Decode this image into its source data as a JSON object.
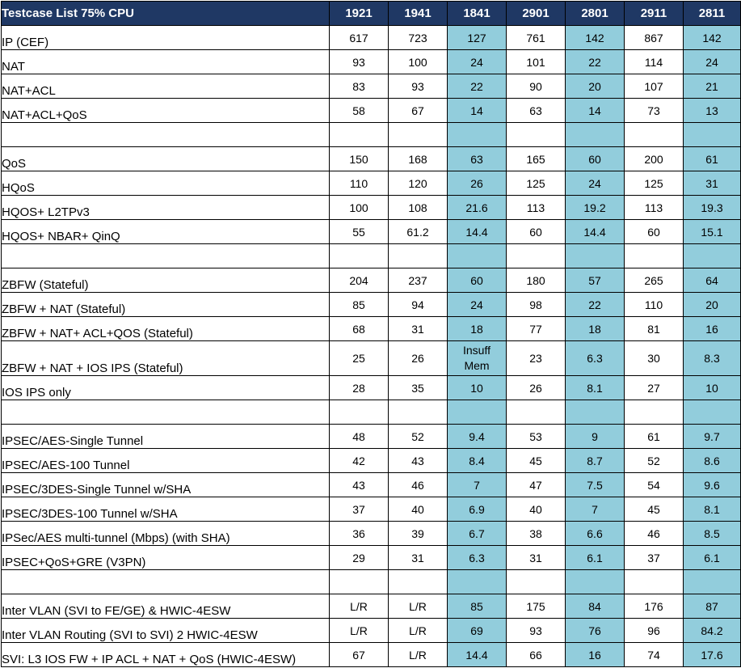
{
  "table": {
    "columns": [
      "Testcase List 75% CPU",
      "1921",
      "1941",
      "1841",
      "2901",
      "2801",
      "2911",
      "2811"
    ],
    "highlight_columns": [
      3,
      5,
      7
    ],
    "rows": [
      {
        "label": "IP (CEF)",
        "values": [
          "617",
          "723",
          "127",
          "761",
          "142",
          "867",
          "142"
        ]
      },
      {
        "label": "NAT",
        "values": [
          "93",
          "100",
          "24",
          "101",
          "22",
          "114",
          "24"
        ]
      },
      {
        "label": "NAT+ACL",
        "values": [
          "83",
          "93",
          "22",
          "90",
          "20",
          "107",
          "21"
        ]
      },
      {
        "label": "NAT+ACL+QoS",
        "values": [
          "58",
          "67",
          "14",
          "63",
          "14",
          "73",
          "13"
        ]
      },
      {
        "label": "",
        "values": [
          "",
          "",
          "",
          "",
          "",
          "",
          ""
        ]
      },
      {
        "label": "QoS",
        "values": [
          "150",
          "168",
          "63",
          "165",
          "60",
          "200",
          "61"
        ]
      },
      {
        "label": "HQoS",
        "values": [
          "110",
          "120",
          "26",
          "125",
          "24",
          "125",
          "31"
        ]
      },
      {
        "label": "HQOS+ L2TPv3",
        "values": [
          "100",
          "108",
          "21.6",
          "113",
          "19.2",
          "113",
          "19.3"
        ]
      },
      {
        "label": "HQOS+ NBAR+ QinQ",
        "values": [
          "55",
          "61.2",
          "14.4",
          "60",
          "14.4",
          "60",
          "15.1"
        ]
      },
      {
        "label": "",
        "values": [
          "",
          "",
          "",
          "",
          "",
          "",
          ""
        ]
      },
      {
        "label": "ZBFW (Stateful)",
        "values": [
          "204",
          "237",
          "60",
          "180",
          "57",
          "265",
          "64"
        ]
      },
      {
        "label": "ZBFW + NAT (Stateful)",
        "values": [
          "85",
          "94",
          "24",
          "98",
          "22",
          "110",
          "20"
        ]
      },
      {
        "label": "ZBFW + NAT+ ACL+QOS (Stateful)",
        "values": [
          "68",
          "31",
          "18",
          "77",
          "18",
          "81",
          "16"
        ]
      },
      {
        "label": "ZBFW + NAT + IOS IPS (Stateful)",
        "values": [
          "25",
          "26",
          "Insuff Mem",
          "23",
          "6.3",
          "30",
          "8.3"
        ]
      },
      {
        "label": "IOS IPS only",
        "values": [
          "28",
          "35",
          "10",
          "26",
          "8.1",
          "27",
          "10"
        ]
      },
      {
        "label": "",
        "values": [
          "",
          "",
          "",
          "",
          "",
          "",
          ""
        ]
      },
      {
        "label": "IPSEC/AES-Single Tunnel",
        "values": [
          "48",
          "52",
          "9.4",
          "53",
          "9",
          "61",
          "9.7"
        ]
      },
      {
        "label": "IPSEC/AES-100 Tunnel",
        "values": [
          "42",
          "43",
          "8.4",
          "45",
          "8.7",
          "52",
          "8.6"
        ]
      },
      {
        "label": "IPSEC/3DES-Single Tunnel w/SHA",
        "values": [
          "43",
          "46",
          "7",
          "47",
          "7.5",
          "54",
          "9.6"
        ]
      },
      {
        "label": "IPSEC/3DES-100 Tunnel w/SHA",
        "values": [
          "37",
          "40",
          "6.9",
          "40",
          "7",
          "45",
          "8.1"
        ]
      },
      {
        "label": "IPSec/AES multi-tunnel (Mbps)  (with SHA)",
        "values": [
          "36",
          "39",
          "6.7",
          "38",
          "6.6",
          "46",
          "8.5"
        ]
      },
      {
        "label": "IPSEC+QoS+GRE (V3PN)",
        "values": [
          "29",
          "31",
          "6.3",
          "31",
          "6.1",
          "37",
          "6.1"
        ]
      },
      {
        "label": "",
        "values": [
          "",
          "",
          "",
          "",
          "",
          "",
          ""
        ]
      },
      {
        "label": "Inter VLAN (SVI to FE/GE) & HWIC-4ESW",
        "values": [
          "L/R",
          "L/R",
          "85",
          "175",
          "84",
          "176",
          "87"
        ]
      },
      {
        "label": "Inter VLAN Routing (SVI to SVI) 2 HWIC-4ESW",
        "values": [
          "L/R",
          "L/R",
          "69",
          "93",
          "76",
          "96",
          "84.2"
        ]
      },
      {
        "label": "SVI: L3 IOS FW + IP ACL + NAT + QoS (HWIC-4ESW)",
        "values": [
          "67",
          "L/R",
          "14.4",
          "66",
          "16",
          "74",
          "17.6"
        ]
      }
    ]
  }
}
